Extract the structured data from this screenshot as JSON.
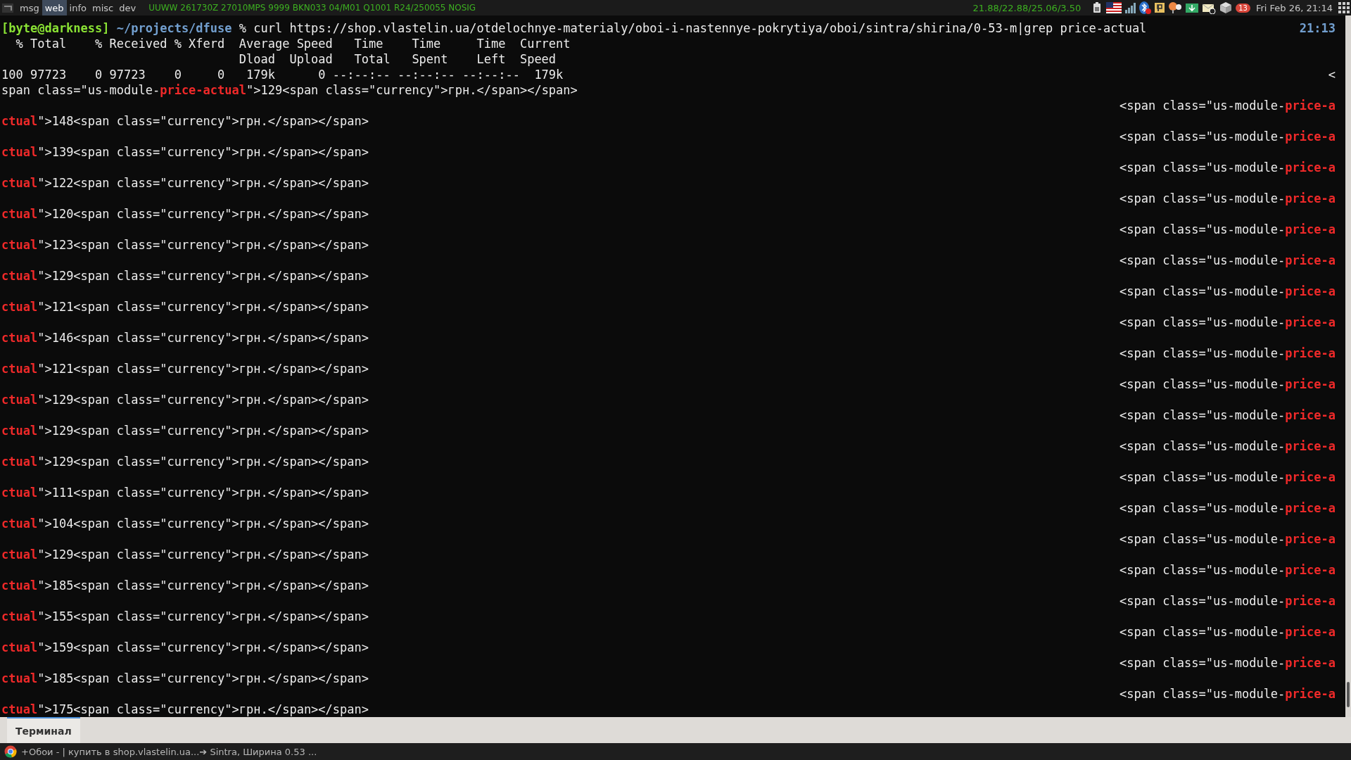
{
  "top_bar": {
    "workspaces": [
      {
        "label": "msg",
        "selected": false
      },
      {
        "label": "web",
        "selected": true
      },
      {
        "label": "info",
        "selected": false
      },
      {
        "label": "misc",
        "selected": false
      },
      {
        "label": "dev",
        "selected": false
      }
    ],
    "weather": "UUWW 261730Z 27010MPS 9999 BKN033 04/M01 Q1001 R24/250055 NOSIG",
    "load": "21.88/22.88/25.06/3.50",
    "notification_count": "13",
    "clock": "Fri Feb 26, 21:14"
  },
  "terminal": {
    "rows": [
      {
        "left": [
          {
            "text": "[byte@darkness]",
            "kind": "user"
          },
          {
            "text": " ~/projects/dfuse",
            "kind": "path"
          },
          {
            "text": " % curl https://shop.vlastelin.ua/otdelochnye-materialy/oboi-i-nastennye-pokrytiya/oboi/sintra/shirina/0-53-m|grep price-actual",
            "kind": "plain"
          }
        ],
        "right": [
          {
            "text": "21:13",
            "kind": "path"
          }
        ]
      },
      {
        "left": [
          {
            "text": "  % Total    % Received % Xferd  Average Speed   Time    Time     Time  Current",
            "kind": "plain"
          }
        ]
      },
      {
        "left": [
          {
            "text": "                                 Dload  Upload   Total   Spent    Left  Speed",
            "kind": "plain"
          }
        ]
      },
      {
        "left": [
          {
            "text": "100 97723    0 97723    0     0   179k      0 --:--:-- --:--:-- --:--:--  179k",
            "kind": "plain"
          }
        ],
        "right": [
          {
            "text": "<",
            "kind": "plain"
          }
        ]
      },
      {
        "left": [
          {
            "text": "span class=\"us-module-",
            "kind": "plain"
          },
          {
            "text": "price-actual",
            "kind": "match"
          },
          {
            "text": "\">129<span class=\"currency\">грн.</span></span>",
            "kind": "plain"
          }
        ]
      },
      {
        "right": [
          {
            "text": "<span class=\"us-module-",
            "kind": "plain"
          },
          {
            "text": "price-a",
            "kind": "match"
          }
        ]
      },
      {
        "left": [
          {
            "text": "ctual",
            "kind": "match"
          },
          {
            "text": "\">148<span class=\"currency\">грн.</span></span>",
            "kind": "plain"
          }
        ]
      },
      {
        "right": [
          {
            "text": "<span class=\"us-module-",
            "kind": "plain"
          },
          {
            "text": "price-a",
            "kind": "match"
          }
        ]
      },
      {
        "left": [
          {
            "text": "ctual",
            "kind": "match"
          },
          {
            "text": "\">139<span class=\"currency\">грн.</span></span>",
            "kind": "plain"
          }
        ]
      },
      {
        "right": [
          {
            "text": "<span class=\"us-module-",
            "kind": "plain"
          },
          {
            "text": "price-a",
            "kind": "match"
          }
        ]
      },
      {
        "left": [
          {
            "text": "ctual",
            "kind": "match"
          },
          {
            "text": "\">122<span class=\"currency\">грн.</span></span>",
            "kind": "plain"
          }
        ]
      },
      {
        "right": [
          {
            "text": "<span class=\"us-module-",
            "kind": "plain"
          },
          {
            "text": "price-a",
            "kind": "match"
          }
        ]
      },
      {
        "left": [
          {
            "text": "ctual",
            "kind": "match"
          },
          {
            "text": "\">120<span class=\"currency\">грн.</span></span>",
            "kind": "plain"
          }
        ]
      },
      {
        "right": [
          {
            "text": "<span class=\"us-module-",
            "kind": "plain"
          },
          {
            "text": "price-a",
            "kind": "match"
          }
        ]
      },
      {
        "left": [
          {
            "text": "ctual",
            "kind": "match"
          },
          {
            "text": "\">123<span class=\"currency\">грн.</span></span>",
            "kind": "plain"
          }
        ]
      },
      {
        "right": [
          {
            "text": "<span class=\"us-module-",
            "kind": "plain"
          },
          {
            "text": "price-a",
            "kind": "match"
          }
        ]
      },
      {
        "left": [
          {
            "text": "ctual",
            "kind": "match"
          },
          {
            "text": "\">129<span class=\"currency\">грн.</span></span>",
            "kind": "plain"
          }
        ]
      },
      {
        "right": [
          {
            "text": "<span class=\"us-module-",
            "kind": "plain"
          },
          {
            "text": "price-a",
            "kind": "match"
          }
        ]
      },
      {
        "left": [
          {
            "text": "ctual",
            "kind": "match"
          },
          {
            "text": "\">121<span class=\"currency\">грн.</span></span>",
            "kind": "plain"
          }
        ]
      },
      {
        "right": [
          {
            "text": "<span class=\"us-module-",
            "kind": "plain"
          },
          {
            "text": "price-a",
            "kind": "match"
          }
        ]
      },
      {
        "left": [
          {
            "text": "ctual",
            "kind": "match"
          },
          {
            "text": "\">146<span class=\"currency\">грн.</span></span>",
            "kind": "plain"
          }
        ]
      },
      {
        "right": [
          {
            "text": "<span class=\"us-module-",
            "kind": "plain"
          },
          {
            "text": "price-a",
            "kind": "match"
          }
        ]
      },
      {
        "left": [
          {
            "text": "ctual",
            "kind": "match"
          },
          {
            "text": "\">121<span class=\"currency\">грн.</span></span>",
            "kind": "plain"
          }
        ]
      },
      {
        "right": [
          {
            "text": "<span class=\"us-module-",
            "kind": "plain"
          },
          {
            "text": "price-a",
            "kind": "match"
          }
        ]
      },
      {
        "left": [
          {
            "text": "ctual",
            "kind": "match"
          },
          {
            "text": "\">129<span class=\"currency\">грн.</span></span>",
            "kind": "plain"
          }
        ]
      },
      {
        "right": [
          {
            "text": "<span class=\"us-module-",
            "kind": "plain"
          },
          {
            "text": "price-a",
            "kind": "match"
          }
        ]
      },
      {
        "left": [
          {
            "text": "ctual",
            "kind": "match"
          },
          {
            "text": "\">129<span class=\"currency\">грн.</span></span>",
            "kind": "plain"
          }
        ]
      },
      {
        "right": [
          {
            "text": "<span class=\"us-module-",
            "kind": "plain"
          },
          {
            "text": "price-a",
            "kind": "match"
          }
        ]
      },
      {
        "left": [
          {
            "text": "ctual",
            "kind": "match"
          },
          {
            "text": "\">129<span class=\"currency\">грн.</span></span>",
            "kind": "plain"
          }
        ]
      },
      {
        "right": [
          {
            "text": "<span class=\"us-module-",
            "kind": "plain"
          },
          {
            "text": "price-a",
            "kind": "match"
          }
        ]
      },
      {
        "left": [
          {
            "text": "ctual",
            "kind": "match"
          },
          {
            "text": "\">111<span class=\"currency\">грн.</span></span>",
            "kind": "plain"
          }
        ]
      },
      {
        "right": [
          {
            "text": "<span class=\"us-module-",
            "kind": "plain"
          },
          {
            "text": "price-a",
            "kind": "match"
          }
        ]
      },
      {
        "left": [
          {
            "text": "ctual",
            "kind": "match"
          },
          {
            "text": "\">104<span class=\"currency\">грн.</span></span>",
            "kind": "plain"
          }
        ]
      },
      {
        "right": [
          {
            "text": "<span class=\"us-module-",
            "kind": "plain"
          },
          {
            "text": "price-a",
            "kind": "match"
          }
        ]
      },
      {
        "left": [
          {
            "text": "ctual",
            "kind": "match"
          },
          {
            "text": "\">129<span class=\"currency\">грн.</span></span>",
            "kind": "plain"
          }
        ]
      },
      {
        "right": [
          {
            "text": "<span class=\"us-module-",
            "kind": "plain"
          },
          {
            "text": "price-a",
            "kind": "match"
          }
        ]
      },
      {
        "left": [
          {
            "text": "ctual",
            "kind": "match"
          },
          {
            "text": "\">185<span class=\"currency\">грн.</span></span>",
            "kind": "plain"
          }
        ]
      },
      {
        "right": [
          {
            "text": "<span class=\"us-module-",
            "kind": "plain"
          },
          {
            "text": "price-a",
            "kind": "match"
          }
        ]
      },
      {
        "left": [
          {
            "text": "ctual",
            "kind": "match"
          },
          {
            "text": "\">155<span class=\"currency\">грн.</span></span>",
            "kind": "plain"
          }
        ]
      },
      {
        "right": [
          {
            "text": "<span class=\"us-module-",
            "kind": "plain"
          },
          {
            "text": "price-a",
            "kind": "match"
          }
        ]
      },
      {
        "left": [
          {
            "text": "ctual",
            "kind": "match"
          },
          {
            "text": "\">159<span class=\"currency\">грн.</span></span>",
            "kind": "plain"
          }
        ]
      },
      {
        "right": [
          {
            "text": "<span class=\"us-module-",
            "kind": "plain"
          },
          {
            "text": "price-a",
            "kind": "match"
          }
        ]
      },
      {
        "left": [
          {
            "text": "ctual",
            "kind": "match"
          },
          {
            "text": "\">185<span class=\"currency\">грн.</span></span>",
            "kind": "plain"
          }
        ]
      },
      {
        "right": [
          {
            "text": "<span class=\"us-module-",
            "kind": "plain"
          },
          {
            "text": "price-a",
            "kind": "match"
          }
        ]
      },
      {
        "left": [
          {
            "text": "ctual",
            "kind": "match"
          },
          {
            "text": "\">175<span class=\"currency\">грн.</span></span>",
            "kind": "plain"
          }
        ]
      }
    ]
  },
  "tabs": [
    {
      "label": "Терминал",
      "selected": true
    }
  ],
  "taskbar": {
    "window_title": "+Обои - | купить в shop.vlastelin.ua...➔ Sintra, Ширина 0.53 ..."
  }
}
